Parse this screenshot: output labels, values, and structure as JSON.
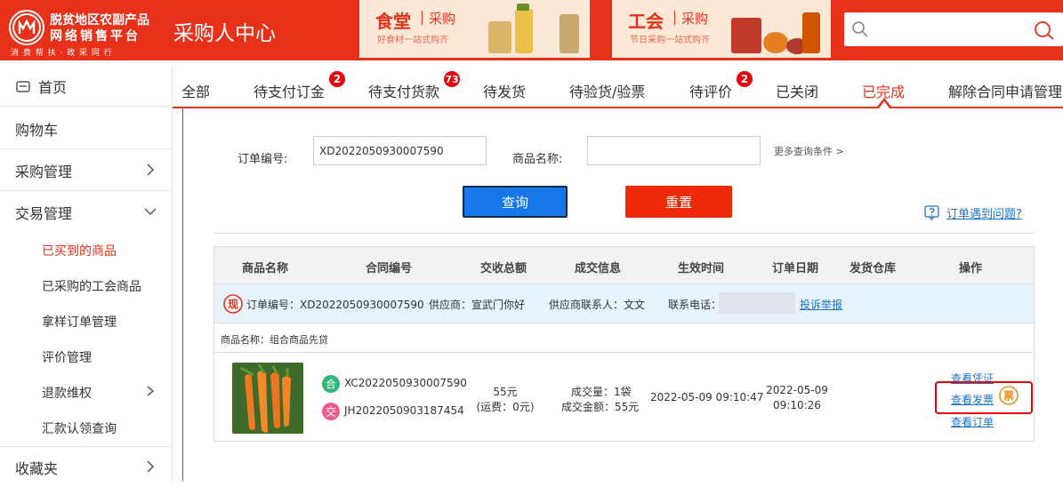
{
  "header": {
    "logo_line1": "脱贫地区农副产品",
    "logo_line2": "网络销售平台",
    "logo_line3": "消 费 帮 扶 · 政 采 同 行",
    "site_title": "采购人中心",
    "banners": [
      {
        "title": "食堂",
        "tag": "采购",
        "subtitle": "好食材一站式购齐"
      },
      {
        "title": "工会",
        "tag": "采购",
        "subtitle": "节日采购一站式购齐"
      }
    ],
    "search_placeholder": ""
  },
  "sidebar": {
    "items": [
      {
        "label": "首页",
        "icon": "home-icon"
      },
      {
        "label": "购物车"
      },
      {
        "label": "采购管理",
        "icon": "chevron-right-icon"
      },
      {
        "label": "交易管理",
        "icon": "chevron-down-icon"
      },
      {
        "label": "收藏夹",
        "icon": "chevron-right-icon"
      }
    ],
    "sub_items": [
      {
        "label": "已买到的商品",
        "active": true
      },
      {
        "label": "已采购的工会商品"
      },
      {
        "label": "拿样订单管理"
      },
      {
        "label": "评价管理"
      },
      {
        "label": "退款维权",
        "icon": "chevron-right-icon"
      },
      {
        "label": "汇款认领查询"
      }
    ]
  },
  "tabs": [
    {
      "label": "全部"
    },
    {
      "label": "待支付订金",
      "badge": "2"
    },
    {
      "label": "待支付货款",
      "badge": "73"
    },
    {
      "label": "待发货"
    },
    {
      "label": "待验货/验票"
    },
    {
      "label": "待评价",
      "badge": "2"
    },
    {
      "label": "已关闭"
    },
    {
      "label": "已完成",
      "active": true
    },
    {
      "label": "解除合同申请管理"
    }
  ],
  "filters": {
    "order_no_label": "订单编号:",
    "order_no_value": "XD2022050930007590",
    "product_name_label": "商品名称:",
    "product_name_value": "",
    "more_conditions": "更多查询条件 >",
    "query_button": "查询",
    "reset_button": "重置",
    "help_link": "订单遇到问题?"
  },
  "table": {
    "headers": [
      "商品名称",
      "合同编号",
      "交收总额",
      "成交信息",
      "生效时间",
      "订单日期",
      "发货仓库",
      "操作"
    ],
    "order": {
      "order_no": "订单编号：XD2022050930007590",
      "supplier": "供应商：宣武门你好",
      "contact": "供应商联系人：文文",
      "phone_label": "联系电话：",
      "complaint_link": "投诉举报",
      "xian_icon_char": "现"
    },
    "product_name_row": "商品名称：组合商品先贷",
    "row": {
      "contract_he": "XC2022050930007590",
      "contract_jiao": "JH2022050903187454",
      "he_char": "合",
      "jiao_char": "交",
      "amount": "55元",
      "freight": "(运费：0元)",
      "qty": "成交量：1袋",
      "deal_amount": "成交金额：55元",
      "effective_time": "2022-05-09 09:10:47",
      "order_date": "2022-05-09",
      "order_time": "09:10:26",
      "ops": [
        "查看凭证",
        "查看发票",
        "查看订单"
      ],
      "piao_char": "票"
    }
  },
  "colors": {
    "brand_red": "#e8311a",
    "link_blue": "#1a74c7",
    "query_blue": "#1677e8",
    "order_bar": "#e8f2fb"
  }
}
